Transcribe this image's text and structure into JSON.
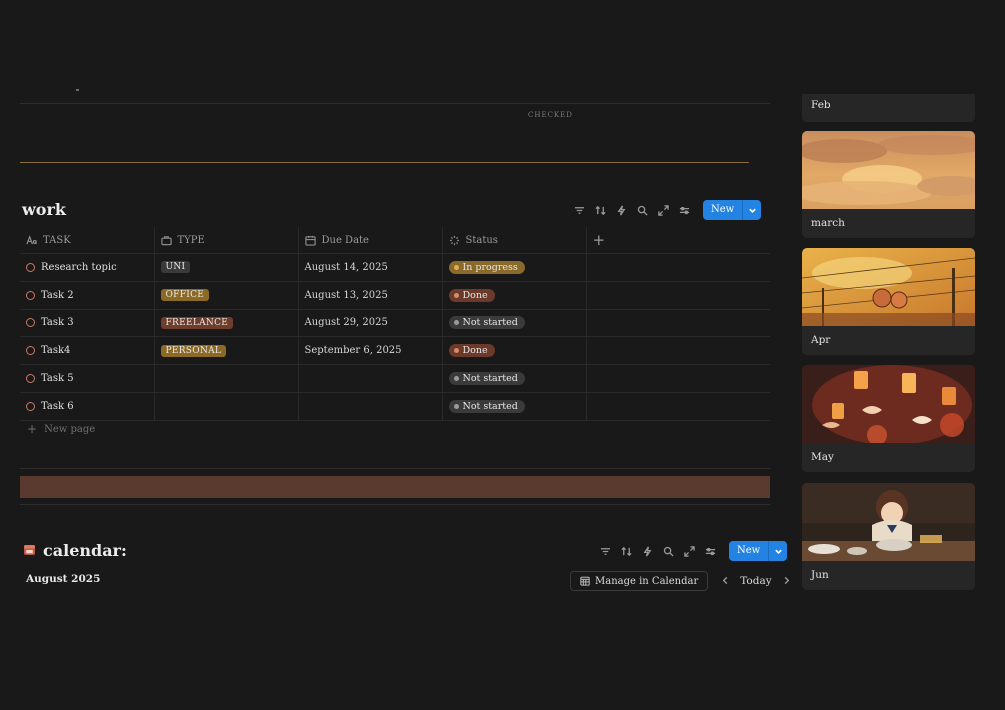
{
  "top_section": {
    "column_label": "CHECKED"
  },
  "work": {
    "title": "work",
    "new_label": "New",
    "columns": [
      {
        "label": "TASK",
        "icon": "text-type-icon"
      },
      {
        "label": "TYPE",
        "icon": "briefcase-icon"
      },
      {
        "label": "Due Date",
        "icon": "calendar-icon"
      },
      {
        "label": "Status",
        "icon": "status-spinner-icon"
      }
    ],
    "rows": [
      {
        "task": "Research topic",
        "type": "UNI",
        "date": "August 14, 2025",
        "status": "In progress"
      },
      {
        "task": "Task 2",
        "type": "OFFICE",
        "date": "August 13, 2025",
        "status": "Done"
      },
      {
        "task": "Task 3",
        "type": "FREELANCE",
        "date": "August 29, 2025",
        "status": "Not started"
      },
      {
        "task": "Task4",
        "type": "PERSONAL",
        "date": "September 6, 2025",
        "status": "Done"
      },
      {
        "task": "Task 5",
        "type": "",
        "date": "",
        "status": "Not started"
      },
      {
        "task": "Task 6",
        "type": "",
        "date": "",
        "status": "Not started"
      }
    ],
    "new_page_label": "New page",
    "type_colors": {
      "UNI": "#3a3a3a",
      "OFFICE": "#8c6a26",
      "FREELANCE": "#6e3d2c",
      "PERSONAL": "#8c6a26"
    },
    "status_colors": {
      "In progress": {
        "bg": "#8a6a2a",
        "dot": "#e0b050"
      },
      "Done": {
        "bg": "#6b3a2a",
        "dot": "#d98a6a"
      },
      "Not started": {
        "bg": "#3a3a3a",
        "dot": "#9b9b9b"
      }
    }
  },
  "divider_banner_color": "#5a3a2e",
  "calendar": {
    "title": "calendar:",
    "month": "August 2025",
    "new_label": "New",
    "manage_label": "Manage in Calendar",
    "today_label": "Today"
  },
  "gallery": [
    {
      "label": "Feb"
    },
    {
      "label": "march"
    },
    {
      "label": "Apr"
    },
    {
      "label": "May"
    },
    {
      "label": "Jun"
    }
  ]
}
